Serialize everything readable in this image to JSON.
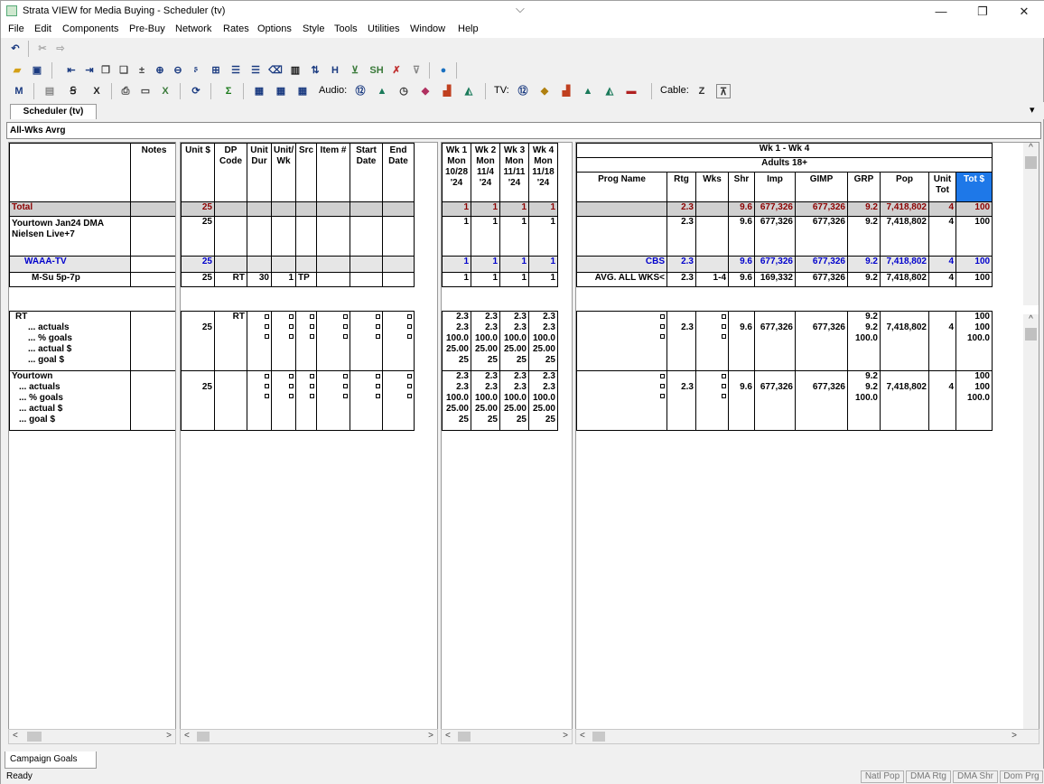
{
  "window": {
    "title": "Strata VIEW for Media Buying - Scheduler (tv)",
    "minimize": "—",
    "restore": "❐",
    "close": "✕"
  },
  "menu": [
    "File",
    "Edit",
    "Components",
    "Pre-Buy",
    "Network",
    "Rates",
    "Options",
    "Style",
    "Tools",
    "Utilities",
    "Window",
    "Help"
  ],
  "toolbar": {
    "audio_label": "Audio:",
    "tv_label": "TV:",
    "cable_label": "Cable:",
    "cable_z": "Z"
  },
  "tab": {
    "label": "Scheduler (tv)"
  },
  "viewbar": {
    "label": "All-Wks Avrg"
  },
  "left_headers": {
    "notes": "Notes"
  },
  "mid_headers": {
    "unit_dollar": "Unit $",
    "dp_code": "DP Code",
    "unit_dur": "Unit Dur",
    "unit_wk": "Unit/ Wk",
    "src": "Src",
    "item": "Item #",
    "start_date": "Start Date",
    "end_date": "End Date"
  },
  "weeks": [
    {
      "wk": "Wk 1",
      "day": "Mon",
      "date": "10/28",
      "yr": "'24"
    },
    {
      "wk": "Wk 2",
      "day": "Mon",
      "date": "11/4",
      "yr": "'24"
    },
    {
      "wk": "Wk 3",
      "day": "Mon",
      "date": "11/11",
      "yr": "'24"
    },
    {
      "wk": "Wk 4",
      "day": "Mon",
      "date": "11/18",
      "yr": "'24"
    }
  ],
  "right_headers": {
    "range": "Wk 1 - Wk 4",
    "demo": "Adults 18+",
    "prog_name": "Prog Name",
    "rtg": "Rtg",
    "wks": "Wks",
    "shr": "Shr",
    "imp": "Imp",
    "gimp": "GIMP",
    "grp": "GRP",
    "pop": "Pop",
    "unit_tot": "Unit Tot",
    "tot_dollar": "Tot $"
  },
  "top_rows": [
    {
      "name": "Total",
      "unit": "25",
      "wk": [
        "1",
        "1",
        "1",
        "1"
      ],
      "prog": "",
      "rtg": "2.3",
      "wks": "",
      "shr": "9.6",
      "imp": "677,326",
      "gimp": "677,326",
      "grp": "9.2",
      "pop": "7,418,802",
      "utot": "4",
      "tot": "100"
    },
    {
      "name": "Yourtown Jan24 DMA Nielsen Live+7",
      "unit": "25",
      "wk": [
        "1",
        "1",
        "1",
        "1"
      ],
      "prog": "",
      "rtg": "2.3",
      "wks": "",
      "shr": "9.6",
      "imp": "677,326",
      "gimp": "677,326",
      "grp": "9.2",
      "pop": "7,418,802",
      "utot": "4",
      "tot": "100"
    },
    {
      "name": "WAAA-TV",
      "unit": "25",
      "wk": [
        "1",
        "1",
        "1",
        "1"
      ],
      "prog": "CBS",
      "rtg": "2.3",
      "wks": "",
      "shr": "9.6",
      "imp": "677,326",
      "gimp": "677,326",
      "grp": "9.2",
      "pop": "7,418,802",
      "utot": "4",
      "tot": "100"
    },
    {
      "name": "M-Su 5p-7p",
      "unit": "25",
      "dp": "RT",
      "dur": "30",
      "uwk": "1",
      "src": "TP",
      "wk": [
        "1",
        "1",
        "1",
        "1"
      ],
      "prog": "AVG. ALL WKS<",
      "rtg": "2.3",
      "wks": "1-4",
      "shr": "9.6",
      "imp": "169,332",
      "gimp": "677,326",
      "grp": "9.2",
      "pop": "7,418,802",
      "utot": "4",
      "tot": "100"
    }
  ],
  "goal_blocks": [
    {
      "name": "RT",
      "sub": [
        "... actuals",
        "... % goals",
        "... actual $",
        "... goal $"
      ],
      "unit": "25",
      "dp": "RT",
      "wk_rows": [
        [
          "2.3",
          "2.3",
          "2.3",
          "2.3"
        ],
        [
          "2.3",
          "2.3",
          "2.3",
          "2.3"
        ],
        [
          "100.0",
          "100.0",
          "100.0",
          "100.0"
        ],
        [
          "25.00",
          "25.00",
          "25.00",
          "25.00"
        ],
        [
          "25",
          "25",
          "25",
          "25"
        ]
      ],
      "rtg": "2.3",
      "shr": "9.6",
      "imp": "677,326",
      "gimp": "677,326",
      "grp": [
        "9.2",
        "9.2",
        "100.0"
      ],
      "pop": "7,418,802",
      "utot": "4",
      "tot": [
        "100",
        "100",
        "100.0"
      ]
    },
    {
      "name": "Yourtown",
      "sub": [
        "... actuals",
        "... % goals",
        "... actual $",
        "... goal $"
      ],
      "unit": "25",
      "dp": "",
      "wk_rows": [
        [
          "2.3",
          "2.3",
          "2.3",
          "2.3"
        ],
        [
          "2.3",
          "2.3",
          "2.3",
          "2.3"
        ],
        [
          "100.0",
          "100.0",
          "100.0",
          "100.0"
        ],
        [
          "25.00",
          "25.00",
          "25.00",
          "25.00"
        ],
        [
          "25",
          "25",
          "25",
          "25"
        ]
      ],
      "rtg": "2.3",
      "shr": "9.6",
      "imp": "677,326",
      "gimp": "677,326",
      "grp": [
        "9.2",
        "9.2",
        "100.0"
      ],
      "pop": "7,418,802",
      "utot": "4",
      "tot": [
        "100",
        "100",
        "100.0"
      ]
    }
  ],
  "bottom_tab": {
    "label": "Campaign Goals"
  },
  "status": {
    "left": "Ready",
    "cells": [
      "Natl Pop",
      "DMA Rtg",
      "DMA Shr",
      "Dom Prg"
    ]
  }
}
